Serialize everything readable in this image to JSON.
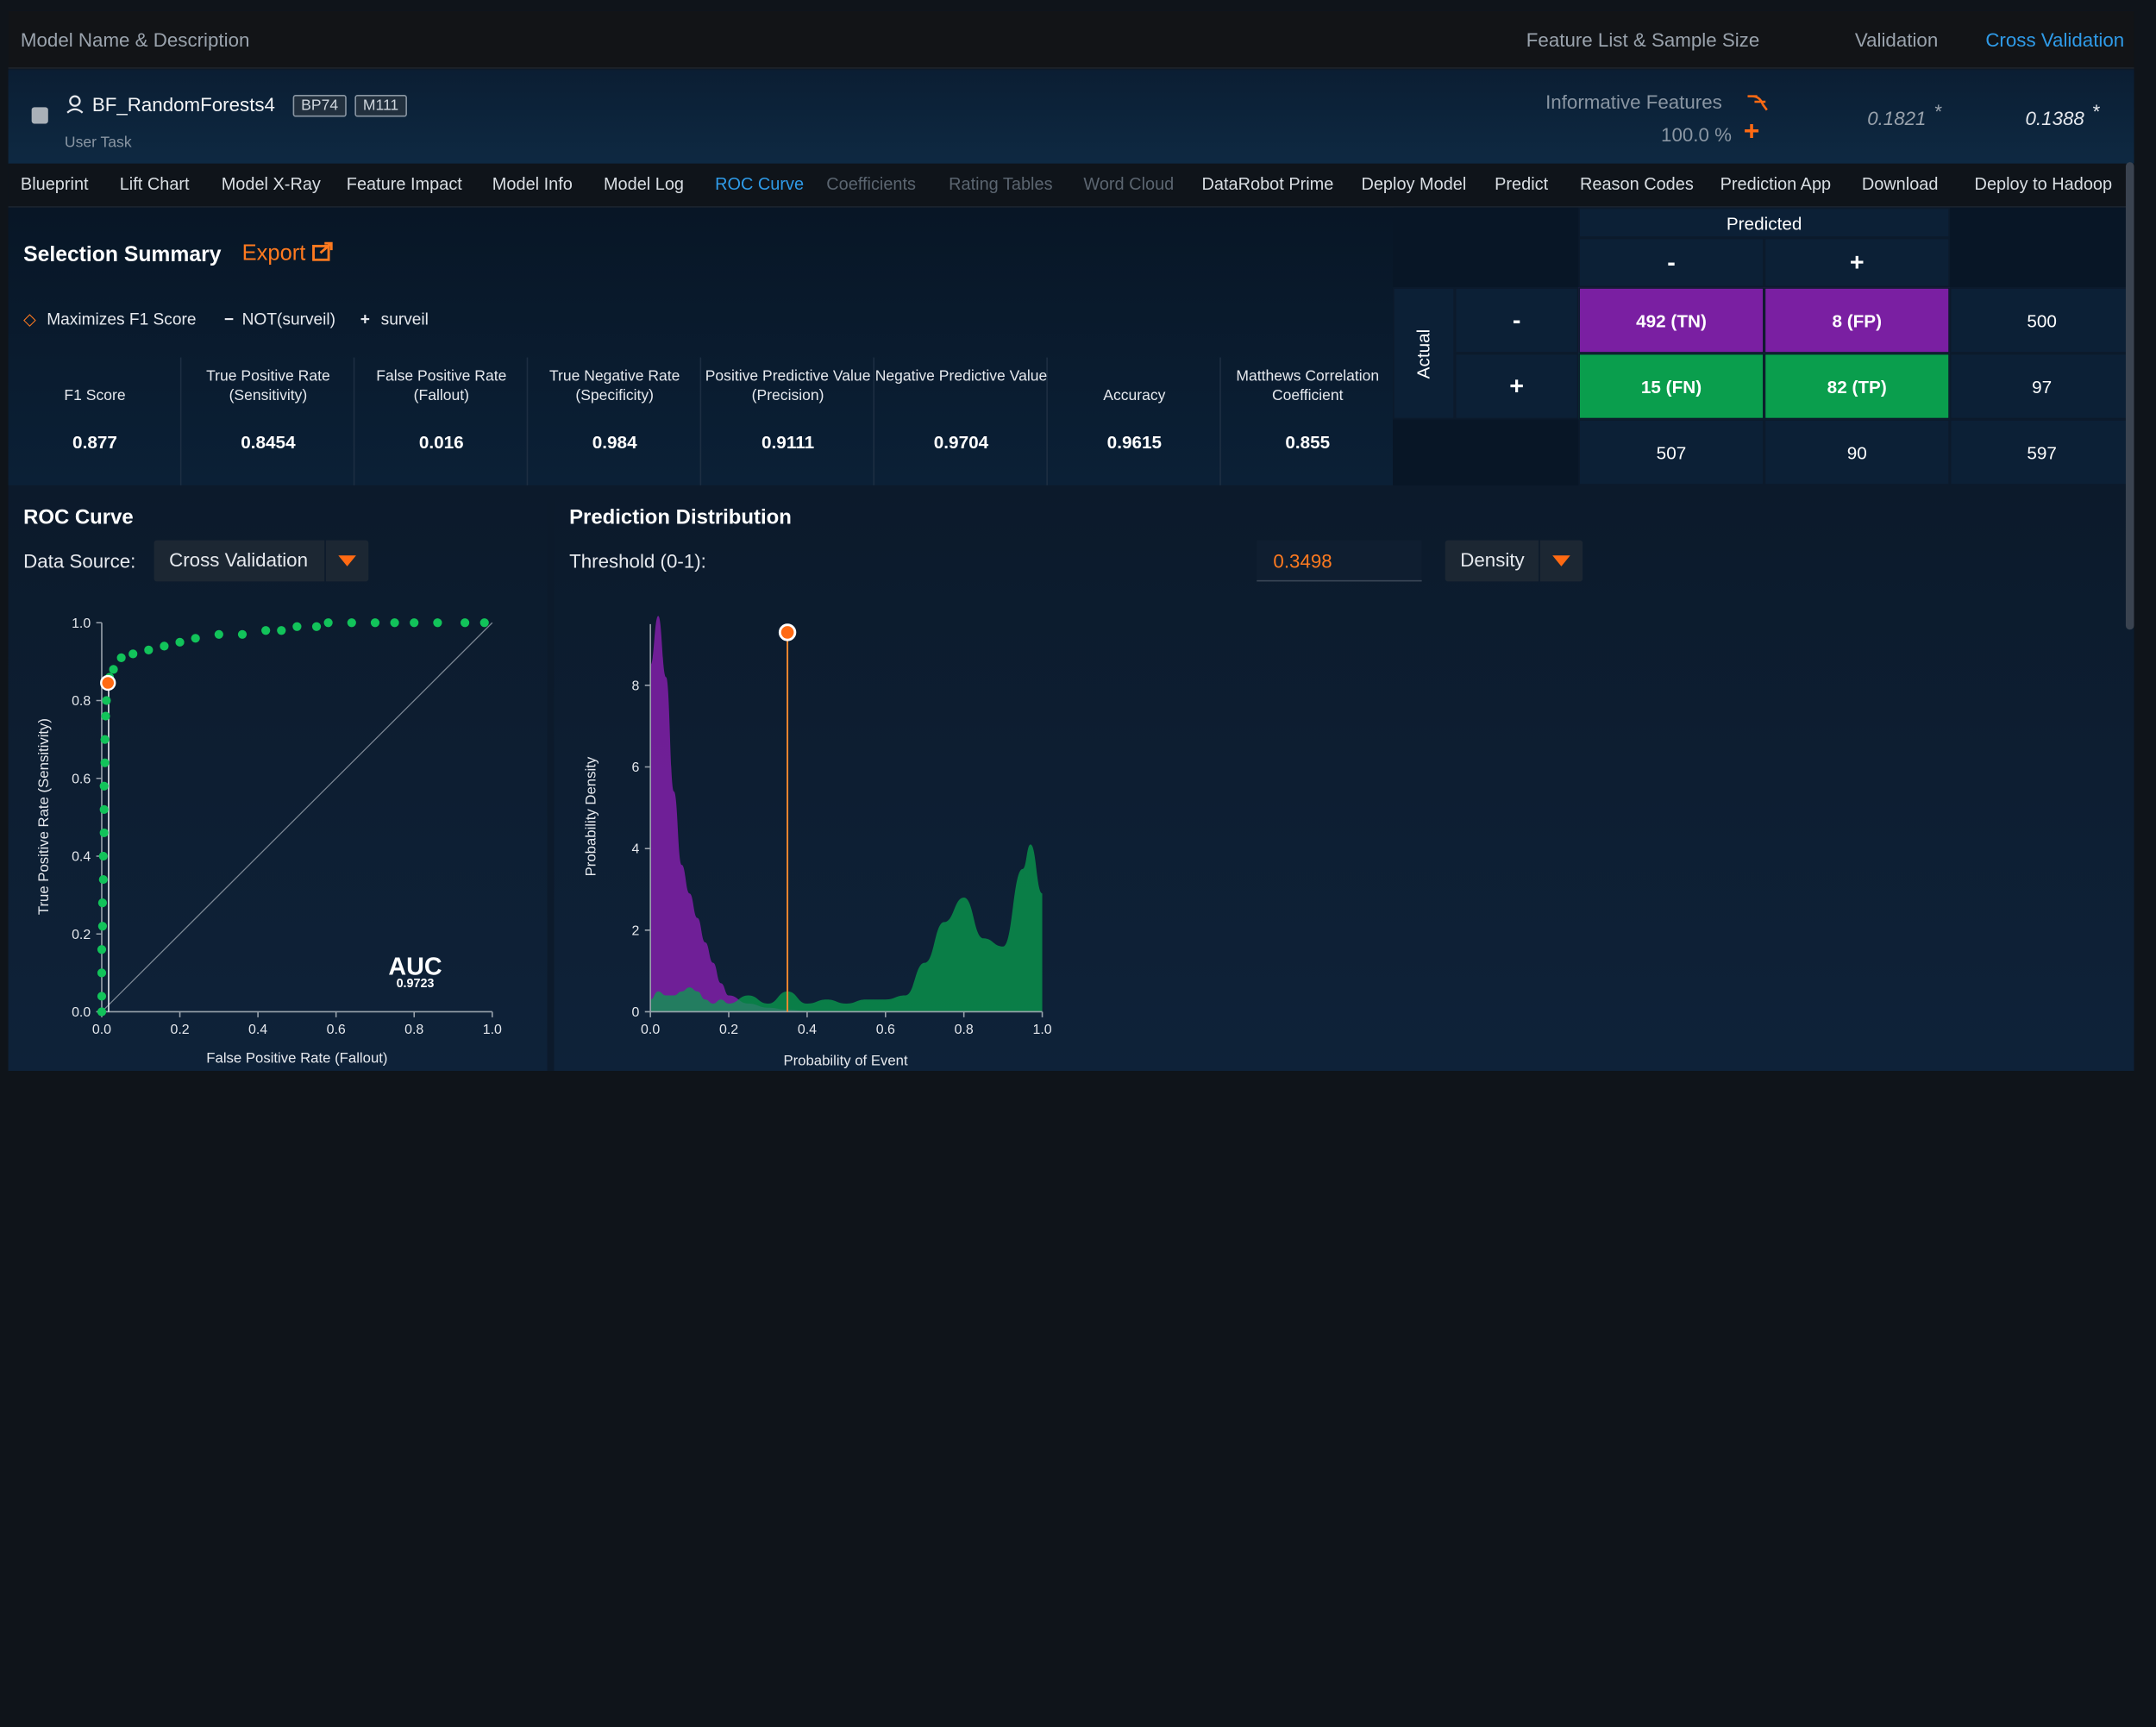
{
  "header": {
    "col_model": "Model Name & Description",
    "col_feature": "Feature List & Sample Size",
    "col_validation": "Validation",
    "col_cv": "Cross Validation"
  },
  "model": {
    "name": "BF_RandomForests4",
    "tag_bp": "BP74",
    "tag_m": "M111",
    "subtitle": "User Task",
    "feature_list": "Informative Features",
    "sample_size": "100.0 %",
    "validation_score": "0.1821",
    "cv_score": "0.1388",
    "asterisk": "*"
  },
  "tabs": [
    {
      "label": "Blueprint",
      "state": "normal"
    },
    {
      "label": "Lift Chart",
      "state": "normal"
    },
    {
      "label": "Model X-Ray",
      "state": "normal"
    },
    {
      "label": "Feature Impact",
      "state": "normal"
    },
    {
      "label": "Model Info",
      "state": "normal"
    },
    {
      "label": "Model Log",
      "state": "normal"
    },
    {
      "label": "ROC Curve",
      "state": "active"
    },
    {
      "label": "Coefficients",
      "state": "disabled"
    },
    {
      "label": "Rating Tables",
      "state": "disabled"
    },
    {
      "label": "Word Cloud",
      "state": "disabled"
    },
    {
      "label": "DataRobot Prime",
      "state": "normal"
    },
    {
      "label": "Deploy Model",
      "state": "normal"
    },
    {
      "label": "Predict",
      "state": "normal"
    },
    {
      "label": "Reason Codes",
      "state": "normal"
    },
    {
      "label": "Prediction App",
      "state": "normal"
    },
    {
      "label": "Download",
      "state": "normal"
    },
    {
      "label": "Deploy to Hadoop",
      "state": "normal"
    }
  ],
  "summary": {
    "title": "Selection Summary",
    "export_label": "Export",
    "legend_maximizes": "Maximizes F1 Score",
    "legend_neg": "NOT(surveil)",
    "legend_pos": "surveil",
    "metrics": [
      {
        "label": "F1 Score",
        "value": "0.877"
      },
      {
        "label": "True Positive Rate (Sensitivity)",
        "value": "0.8454"
      },
      {
        "label": "False Positive Rate (Fallout)",
        "value": "0.016"
      },
      {
        "label": "True Negative Rate (Specificity)",
        "value": "0.984"
      },
      {
        "label": "Positive Predictive Value (Precision)",
        "value": "0.9111"
      },
      {
        "label": "Negative Predictive Value",
        "value": "0.9704"
      },
      {
        "label": "Accuracy",
        "value": "0.9615"
      },
      {
        "label": "Matthews Correlation Coefficient",
        "value": "0.855"
      }
    ]
  },
  "confusion": {
    "predicted_label": "Predicted",
    "actual_label": "Actual",
    "neg_sign": "-",
    "pos_sign": "+",
    "tn": "492 (TN)",
    "fp": "8 (FP)",
    "fn": "15 (FN)",
    "tp": "82 (TP)",
    "row_neg_total": "500",
    "row_pos_total": "97",
    "col_neg_total": "507",
    "col_pos_total": "90",
    "grand_total": "597"
  },
  "roc": {
    "title": "ROC Curve",
    "source_label": "Data Source:",
    "source_value": "Cross Validation",
    "auc_label": "AUC",
    "auc_value": "0.9723"
  },
  "dist": {
    "title": "Prediction Distribution",
    "threshold_label": "Threshold (0-1):",
    "threshold_value": "0.3498",
    "mode_value": "Density"
  },
  "colors": {
    "accent": "#ff6a13",
    "active_tab": "#2f9be8",
    "tn_fp": "#7a1fa2",
    "fn_tp": "#0a9e4d",
    "roc_points": "#12c35a"
  },
  "chart_data": [
    {
      "type": "scatter",
      "title": "",
      "xlabel": "False Positive Rate (Fallout)",
      "ylabel": "True Positive Rate (Sensitivity)",
      "xlim": [
        0,
        1
      ],
      "ylim": [
        0,
        1
      ],
      "x_ticks": [
        "0.0",
        "0.2",
        "0.4",
        "0.6",
        "0.8",
        "1.0"
      ],
      "y_ticks": [
        "0.0",
        "0.2",
        "0.4",
        "0.6",
        "0.8",
        "1.0"
      ],
      "curve": [
        [
          0,
          0
        ],
        [
          0,
          0.04
        ],
        [
          0,
          0.1
        ],
        [
          0,
          0.16
        ],
        [
          0.002,
          0.22
        ],
        [
          0.002,
          0.28
        ],
        [
          0.004,
          0.34
        ],
        [
          0.004,
          0.4
        ],
        [
          0.006,
          0.46
        ],
        [
          0.006,
          0.52
        ],
        [
          0.006,
          0.58
        ],
        [
          0.008,
          0.64
        ],
        [
          0.008,
          0.7
        ],
        [
          0.01,
          0.76
        ],
        [
          0.012,
          0.8
        ],
        [
          0.016,
          0.8454
        ],
        [
          0.02,
          0.86
        ],
        [
          0.03,
          0.88
        ],
        [
          0.05,
          0.91
        ],
        [
          0.08,
          0.92
        ],
        [
          0.12,
          0.93
        ],
        [
          0.16,
          0.94
        ],
        [
          0.2,
          0.95
        ],
        [
          0.24,
          0.96
        ],
        [
          0.3,
          0.97
        ],
        [
          0.36,
          0.97
        ],
        [
          0.42,
          0.98
        ],
        [
          0.46,
          0.98
        ],
        [
          0.5,
          0.99
        ],
        [
          0.55,
          0.99
        ],
        [
          0.58,
          1.0
        ],
        [
          0.64,
          1.0
        ],
        [
          0.7,
          1.0
        ],
        [
          0.75,
          1.0
        ],
        [
          0.8,
          1.0
        ],
        [
          0.86,
          1.0
        ],
        [
          0.93,
          1.0
        ],
        [
          0.98,
          1.0
        ]
      ],
      "selected_point": [
        0.016,
        0.8454
      ],
      "auc": 0.9723
    },
    {
      "type": "area",
      "title": "",
      "xlabel": "Probability of Event",
      "ylabel": "Probability Density",
      "xlim": [
        0,
        1
      ],
      "ylim": [
        0,
        9.5
      ],
      "x_ticks": [
        "0.0",
        "0.2",
        "0.4",
        "0.6",
        "0.8",
        "1.0"
      ],
      "y_ticks": [
        "0",
        "2",
        "4",
        "6",
        "8"
      ],
      "x": [
        0,
        0.02,
        0.04,
        0.06,
        0.08,
        0.1,
        0.12,
        0.14,
        0.16,
        0.18,
        0.2,
        0.25,
        0.3,
        0.35,
        0.4,
        0.45,
        0.5,
        0.55,
        0.6,
        0.65,
        0.7,
        0.75,
        0.8,
        0.85,
        0.9,
        0.95,
        0.97,
        1.0
      ],
      "series": [
        {
          "values": [
            8.5,
            9.7,
            8.2,
            5.4,
            3.6,
            2.9,
            2.3,
            1.7,
            1.2,
            0.7,
            0.4,
            0.2,
            0.1,
            0.05,
            0.02,
            0.02,
            0.01,
            0.01,
            0,
            0,
            0,
            0,
            0,
            0,
            0,
            0,
            0,
            0
          ]
        },
        {
          "values": [
            0.3,
            0.5,
            0.4,
            0.4,
            0.5,
            0.6,
            0.5,
            0.3,
            0.2,
            0.3,
            0.2,
            0.4,
            0.2,
            0.5,
            0.2,
            0.3,
            0.2,
            0.3,
            0.3,
            0.4,
            1.2,
            2.2,
            2.8,
            1.8,
            1.6,
            3.5,
            4.1,
            2.9
          ]
        }
      ],
      "threshold": 0.3498
    }
  ]
}
